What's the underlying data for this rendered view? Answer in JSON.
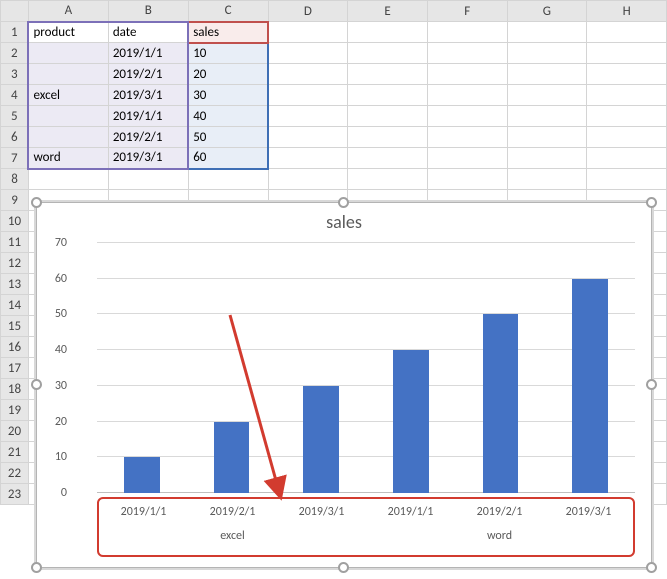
{
  "columns": [
    "A",
    "B",
    "C",
    "D",
    "E",
    "F",
    "G",
    "H"
  ],
  "row_headers": [
    1,
    2,
    3,
    4,
    5,
    6,
    7,
    8,
    9,
    10,
    11,
    12,
    13,
    14,
    15,
    16,
    17,
    18,
    19,
    20,
    21,
    22,
    23
  ],
  "sheet": {
    "A1": "product",
    "B1": "date",
    "C1": "sales",
    "A4": "excel",
    "A7": "word",
    "B2": "2019/1/1",
    "B3": "2019/2/1",
    "B4": "2019/3/1",
    "B5": "2019/1/1",
    "B6": "2019/2/1",
    "B7": "2019/3/1",
    "C2": "10",
    "C3": "20",
    "C4": "30",
    "C5": "40",
    "C6": "50",
    "C7": "60"
  },
  "chart_data": {
    "type": "bar",
    "title": "sales",
    "ylim": [
      0,
      70
    ],
    "ytick_step": 10,
    "xlabel": "",
    "ylabel": "",
    "groups": [
      "excel",
      "word"
    ],
    "categories": [
      "2019/1/1",
      "2019/2/1",
      "2019/3/1",
      "2019/1/1",
      "2019/2/1",
      "2019/3/1"
    ],
    "category_group": [
      "excel",
      "excel",
      "excel",
      "word",
      "word",
      "word"
    ],
    "values": [
      10,
      20,
      30,
      40,
      50,
      60
    ],
    "series_name": "sales",
    "bar_color": "#4472c4"
  },
  "annotation": {
    "type": "arrow",
    "color": "#d23b2f",
    "note": "callout arrow pointing at multi-level category axis"
  }
}
